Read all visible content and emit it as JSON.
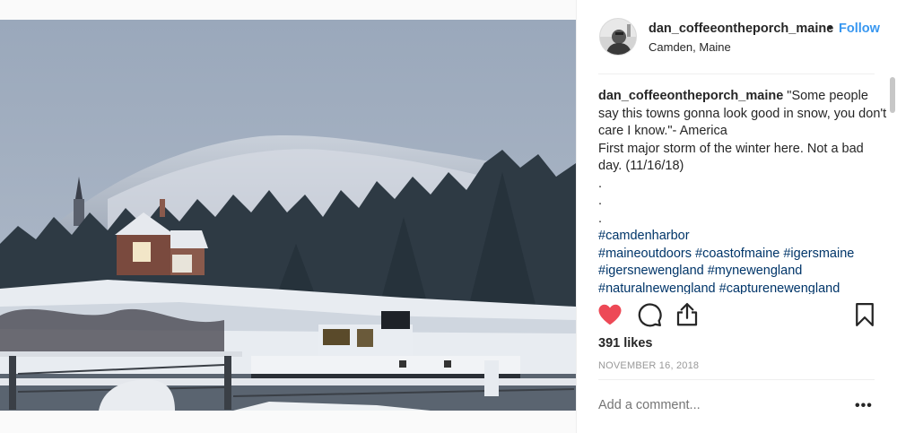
{
  "post": {
    "username": "dan_coffeeontheporch_maine",
    "separator": "•",
    "follow_label": "Follow",
    "location": "Camden, Maine",
    "caption": {
      "username": "dan_coffeeontheporch_maine",
      "text": "\"Some people say this towns gonna look good in snow, you don't care I know.\"- America",
      "line2": "First major storm of the winter here. Not a bad day. (11/16/18)",
      "dot1": ".",
      "dot2": ".",
      "dot3": ".",
      "hashtags": [
        "#camdenharbor",
        "#maineoutdoors #coastofmaine #igersmaine",
        "#igersnewengland #mynewengland",
        "#naturalnewengland #capturenewengland"
      ]
    },
    "likes": "391 likes",
    "date": "NOVEMBER 16, 2018",
    "comment_placeholder": "Add a comment...",
    "more_label": "•••"
  },
  "colors": {
    "heart": "#ed4956",
    "link": "#3897f0",
    "hashtag": "#003569",
    "muted": "#999999"
  },
  "icons": {
    "like": "heart-filled-icon",
    "comment": "comment-bubble-icon",
    "share": "share-icon",
    "save": "bookmark-icon",
    "more": "more-options-icon"
  }
}
